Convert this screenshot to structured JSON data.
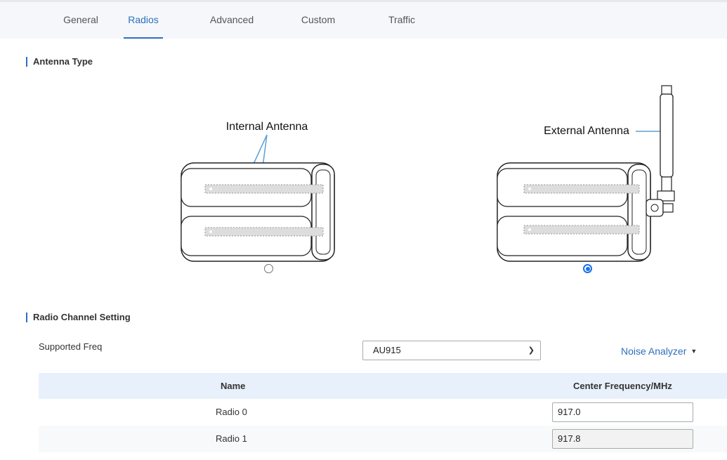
{
  "tabs": [
    {
      "label": "General",
      "active": false
    },
    {
      "label": "Radios",
      "active": true
    },
    {
      "label": "Advanced",
      "active": false
    },
    {
      "label": "Custom",
      "active": false
    },
    {
      "label": "Traffic",
      "active": false
    }
  ],
  "antenna_section": {
    "title": "Antenna Type",
    "internal_label": "Internal Antenna",
    "external_label": "External Antenna",
    "selected": "external"
  },
  "radio_section": {
    "title": "Radio Channel Setting",
    "supported_freq_label": "Supported Freq",
    "supported_freq_value": "AU915",
    "noise_analyzer_label": "Noise Analyzer"
  },
  "table": {
    "headers": {
      "name": "Name",
      "center_freq": "Center Frequency/MHz"
    },
    "rows": [
      {
        "name": "Radio 0",
        "center_freq": "917.0"
      },
      {
        "name": "Radio 1",
        "center_freq": "917.8"
      }
    ]
  },
  "colors": {
    "accent": "#2d6fbe",
    "radio_checked": "#1a73e8",
    "table_header_bg": "#e8f1fb"
  }
}
